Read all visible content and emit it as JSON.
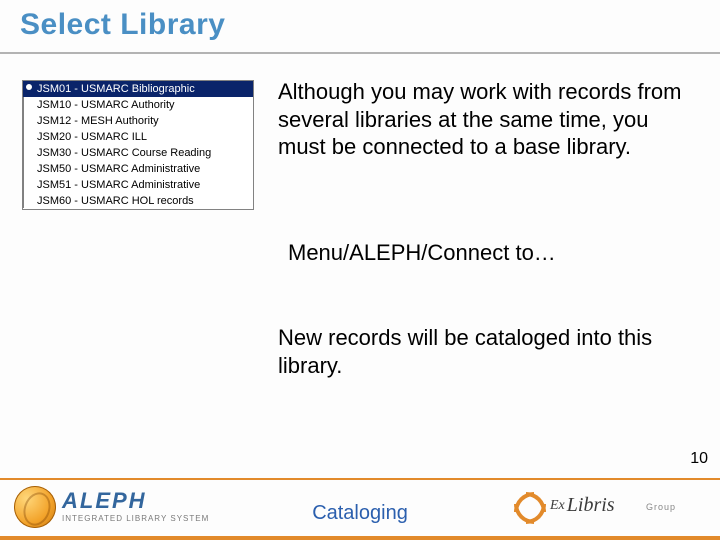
{
  "title": "Select Library",
  "listbox": {
    "items": [
      {
        "label": "JSM01 - USMARC Bibliographic",
        "selected": true
      },
      {
        "label": "JSM10 - USMARC Authority",
        "selected": false
      },
      {
        "label": "JSM12 - MESH Authority",
        "selected": false
      },
      {
        "label": "JSM20 - USMARC ILL",
        "selected": false
      },
      {
        "label": "JSM30 - USMARC Course Reading",
        "selected": false
      },
      {
        "label": "JSM50 - USMARC Administrative",
        "selected": false
      },
      {
        "label": "JSM51 - USMARC Administrative",
        "selected": false
      },
      {
        "label": "JSM60 - USMARC HOL records",
        "selected": false
      }
    ]
  },
  "body": {
    "para1": "Although you may work with records from several libraries at the same time, you must be connected to a base library.",
    "menu_path": "Menu/ALEPH/Connect to…",
    "para2": "New records will be cataloged into this library."
  },
  "page_number": "10",
  "footer": {
    "center_label": "Cataloging",
    "aleph": {
      "name": "ALEPH",
      "tagline": "INTEGRATED LIBRARY SYSTEM"
    },
    "exlibris": {
      "ex": "Ex",
      "name": "Libris",
      "group": "Group"
    }
  }
}
